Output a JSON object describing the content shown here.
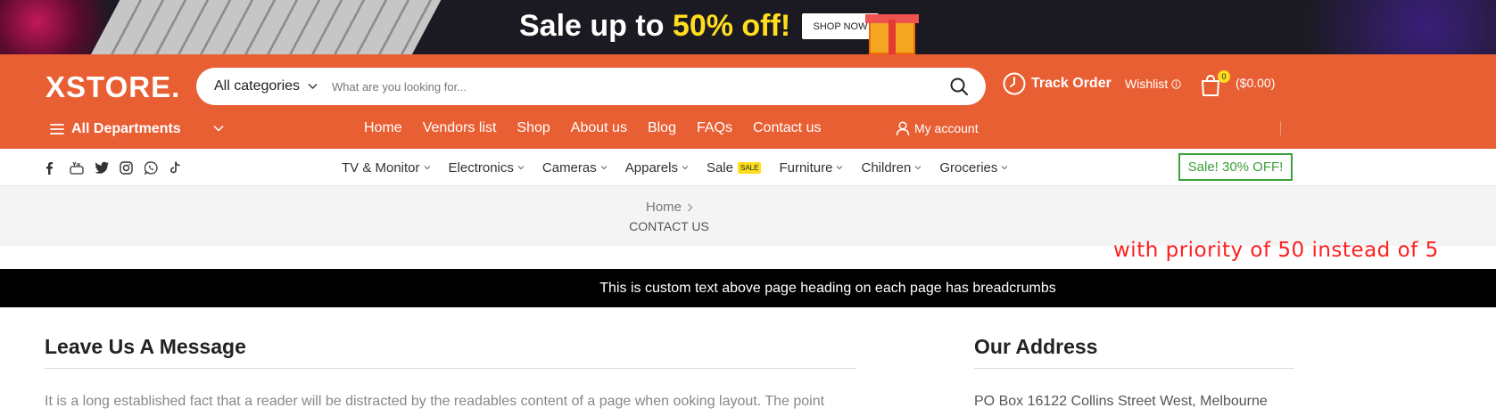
{
  "promo": {
    "headline_prefix": "Sale up to ",
    "headline_highlight": "50% off!",
    "shop_now": "SHOP NOW",
    "highlight_color": "#ffdd1f"
  },
  "header": {
    "logo": "XSTORE.",
    "bg_color": "#e95f34",
    "search": {
      "category": "All categories",
      "placeholder": "What are you looking for..."
    },
    "track_order": "Track Order",
    "wishlist": "Wishlist",
    "cart": {
      "count": "0",
      "total": "($0.00)"
    },
    "departments": "All Departments",
    "nav": [
      "Home",
      "Vendors list",
      "Shop",
      "About us",
      "Blog",
      "FAQs",
      "Contact us"
    ],
    "my_account": "My account"
  },
  "category_bar": {
    "socials": [
      "facebook-icon",
      "youtube-icon",
      "twitter-icon",
      "instagram-icon",
      "whatsapp-icon",
      "tiktok-icon"
    ],
    "items": [
      {
        "label": "TV & Monitor",
        "dropdown": true
      },
      {
        "label": "Electronics",
        "dropdown": true
      },
      {
        "label": "Cameras",
        "dropdown": true
      },
      {
        "label": "Apparels",
        "dropdown": true
      },
      {
        "label": "Sale",
        "dropdown": false,
        "tag": "SALE"
      },
      {
        "label": "Furniture",
        "dropdown": true
      },
      {
        "label": "Children",
        "dropdown": true
      },
      {
        "label": "Groceries",
        "dropdown": true
      }
    ],
    "sale_button": "Sale! 30% OFF!",
    "sale_color": "#3aa13a"
  },
  "breadcrumb": {
    "home": "Home",
    "current": "CONTACT US"
  },
  "notice": "with priority of 50 instead of 5",
  "custom_text": "This is custom text above page heading on each page has breadcrumbs",
  "content": {
    "message_heading": "Leave Us A Message",
    "message_text": "It is a long established fact that a reader will be distracted by the readables content of a page when ooking layout. The point",
    "address_heading": "Our Address",
    "address_text": "PO Box 16122 Collins Street West, Melbourne"
  }
}
